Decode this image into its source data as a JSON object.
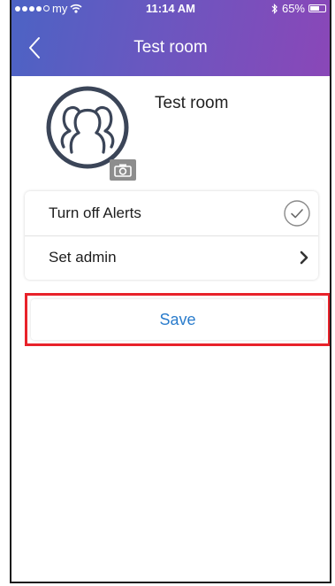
{
  "status_bar": {
    "carrier": "my",
    "time": "11:14 AM",
    "battery": "65%",
    "battery_level": 0.65
  },
  "nav": {
    "title": "Test room",
    "back_icon": "chevron-left-icon"
  },
  "room": {
    "name": "Test room",
    "avatar_icon": "group-avatar-icon",
    "camera_icon": "camera-icon"
  },
  "settings": {
    "items": [
      {
        "label": "Turn off Alerts",
        "icon": "check-circle-icon"
      },
      {
        "label": "Set admin",
        "icon": "chevron-right-icon"
      }
    ]
  },
  "actions": {
    "save_label": "Save"
  },
  "colors": {
    "accent": "#2a7ccc",
    "header_start": "#4c63c4",
    "header_end": "#8a47b8",
    "highlight": "#e8222a"
  }
}
